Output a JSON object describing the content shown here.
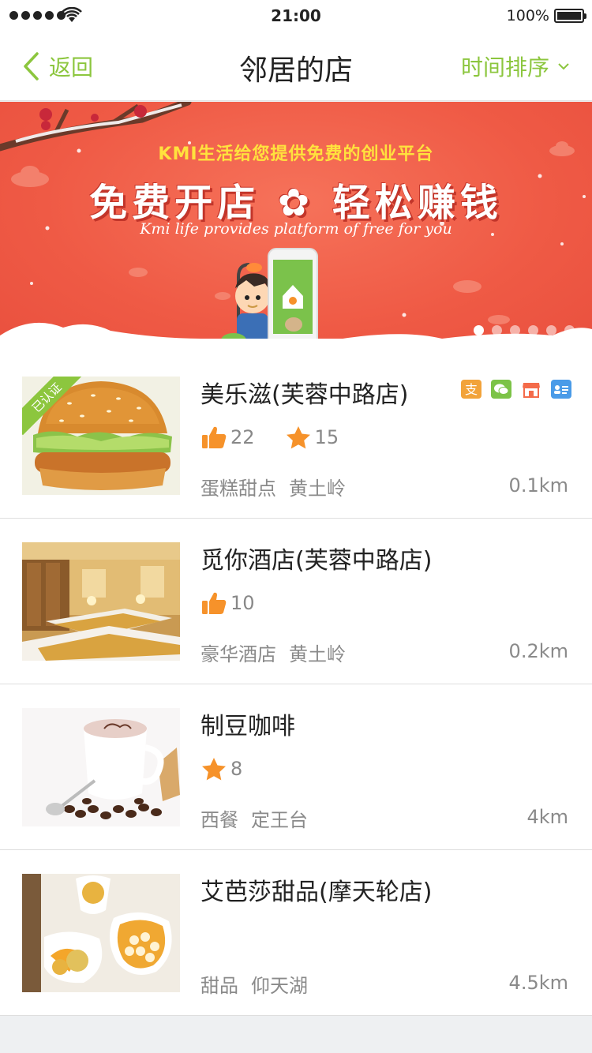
{
  "status_bar": {
    "time": "21:00",
    "battery": "100%"
  },
  "nav": {
    "back_label": "返回",
    "title": "邻居的店",
    "sort_label": "时间排序"
  },
  "banner": {
    "subtitle": "KMI生活给您提供免费的创业平台",
    "headline": "免费开店 ✿ 轻松赚钱",
    "tagline": "Kmi life provides platform of free for you",
    "slide_count": 6,
    "active_slide": 1
  },
  "shops": [
    {
      "name": "美乐滋(芙蓉中路店)",
      "badge": "已认证",
      "likes": "22",
      "stars": "15",
      "category": "蛋糕甜点",
      "area": "黄土岭",
      "distance": "0.1km",
      "icons": [
        "alipay-icon",
        "wechat-pay-icon",
        "storefront-icon",
        "member-card-icon"
      ]
    },
    {
      "name": "觅你酒店(芙蓉中路店)",
      "likes": "10",
      "category": "豪华酒店",
      "area": "黄土岭",
      "distance": "0.2km"
    },
    {
      "name": "制豆咖啡",
      "stars": "8",
      "category": "西餐",
      "area": "定王台",
      "distance": "4km"
    },
    {
      "name": "艾芭莎甜品(摩天轮店)",
      "category": "甜品",
      "area": "仰天湖",
      "distance": "4.5km"
    }
  ],
  "colors": {
    "accent": "#8cc63e",
    "like": "#f6922a",
    "star": "#f6922a",
    "banner": "#ef5a45"
  }
}
